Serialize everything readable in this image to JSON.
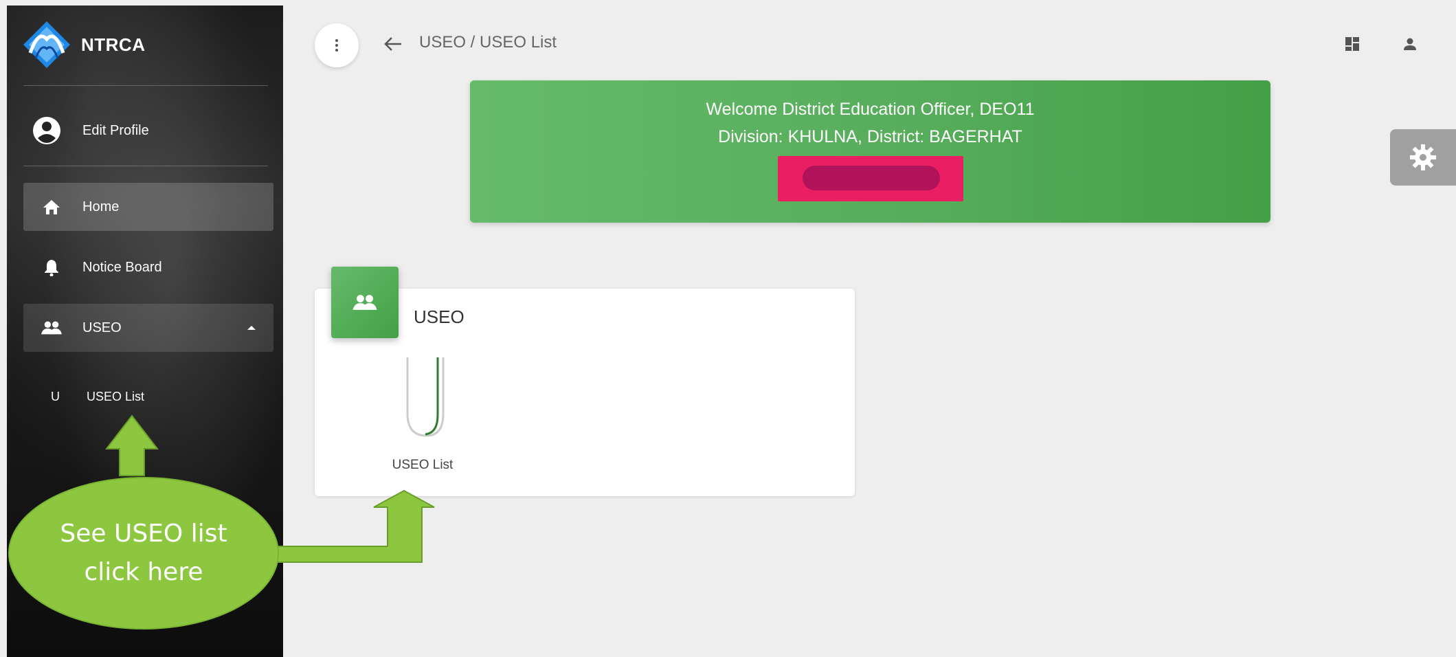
{
  "sidebar": {
    "brand": "NTRCA",
    "profile_label": "Edit Profile",
    "items": [
      {
        "label": "Home"
      },
      {
        "label": "Notice Board"
      },
      {
        "label": "USEO"
      }
    ],
    "sub_item": {
      "mini": "U",
      "label": "USEO List"
    }
  },
  "header": {
    "breadcrumb": "USEO / USEO List"
  },
  "welcome": {
    "line1": "Welcome District Education Officer, DEO11",
    "line2": "Division: KHULNA, District: BAGERHAT"
  },
  "card": {
    "title": "USEO",
    "tile_label": "USEO List"
  },
  "annotation": {
    "text": "See USEO list click here"
  },
  "colors": {
    "accent_green": "#4caf50",
    "callout_green": "#8dc63f",
    "redaction": "#e91e63"
  },
  "icons": {
    "profile": "account-circle-icon",
    "home": "home-icon",
    "notice": "bell-icon",
    "useo": "people-icon",
    "menu": "more-vertical-icon",
    "back": "arrow-left-icon",
    "dashboard": "dashboard-icon",
    "user": "person-icon",
    "settings": "gear-icon"
  }
}
